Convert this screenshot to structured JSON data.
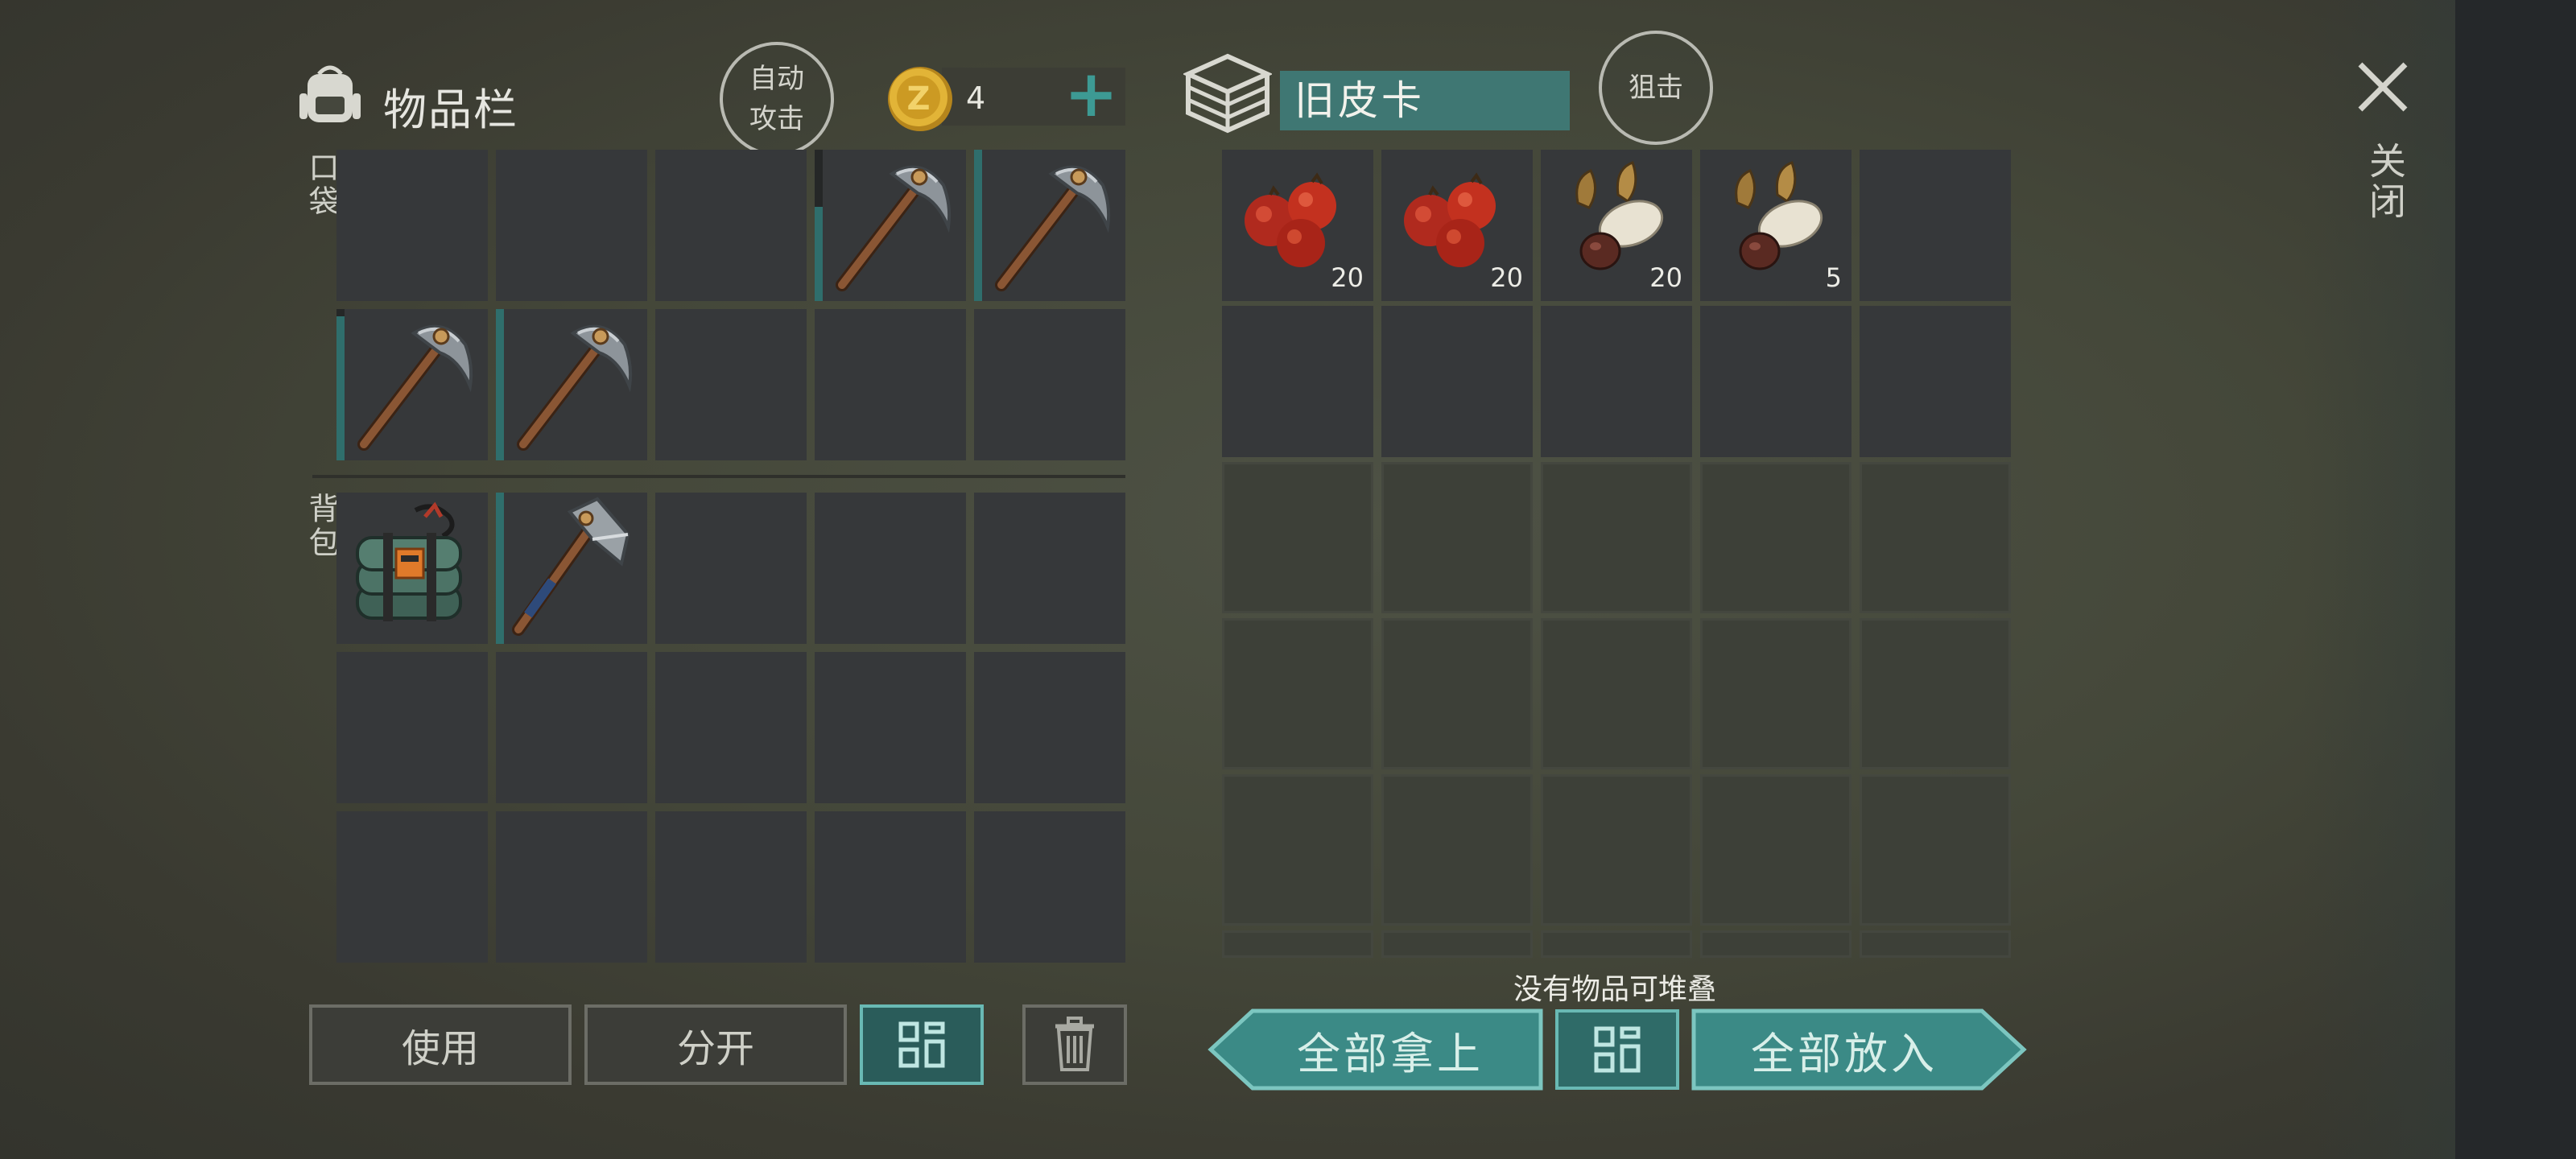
{
  "header": {
    "inventory_title": "物品栏",
    "auto_attack_label": "自动\n攻击",
    "coin_count": "4",
    "add_coin_symbol": "+",
    "container_name": "旧皮卡",
    "snipe_label": "狙击",
    "close_label": "关闭"
  },
  "sections": {
    "pocket_label": "口袋",
    "backpack_label": "背包"
  },
  "pocket": [
    {
      "item": "",
      "durability": null
    },
    {
      "item": "",
      "durability": null
    },
    {
      "item": "",
      "durability": null
    },
    {
      "item": "pickaxe-icon",
      "durability": 0.62
    },
    {
      "item": "pickaxe-icon",
      "durability": 1.0
    },
    {
      "item": "pickaxe-icon",
      "durability": 0.95
    },
    {
      "item": "pickaxe-icon",
      "durability": 1.0
    },
    {
      "item": "",
      "durability": null
    },
    {
      "item": "",
      "durability": null
    },
    {
      "item": "",
      "durability": null
    }
  ],
  "backpack_items": [
    {
      "item": "explosive-bundle-icon",
      "durability": null
    },
    {
      "item": "hammer-axe-icon",
      "durability": 1.0
    }
  ],
  "container_items": [
    {
      "item": "berries-icon",
      "count": "20"
    },
    {
      "item": "berries-icon",
      "count": "20"
    },
    {
      "item": "seeds-icon",
      "count": "20"
    },
    {
      "item": "seeds-icon",
      "count": "5"
    }
  ],
  "status_text": "没有物品可堆叠",
  "buttons": {
    "use": "使用",
    "split": "分开",
    "take_all": "全部拿上",
    "put_all": "全部放入"
  },
  "colors": {
    "accent_teal": "#2f6e6c",
    "button_teal": "#3b8a86",
    "coin_gold": "#d9a82a",
    "bg": "#444739"
  }
}
